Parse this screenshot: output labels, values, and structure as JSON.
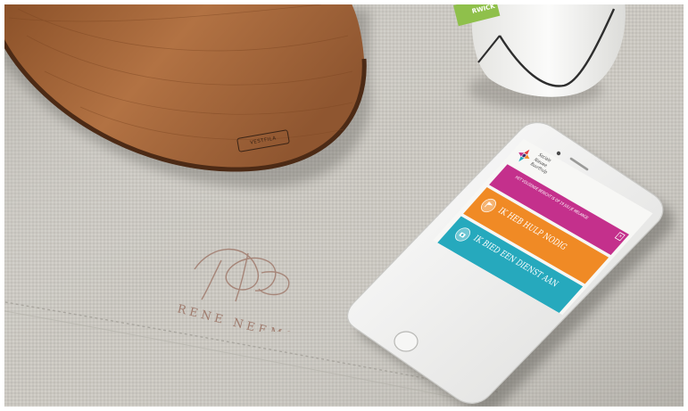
{
  "scene": {
    "description_colors": {
      "cloth": "#c7c4bd",
      "board": "#a0653a",
      "mug": "#f2f2f0",
      "phone_body": "#f4f4f2",
      "pink": "#c4308c",
      "orange": "#f08a25",
      "teal": "#26a9bd"
    }
  },
  "board": {
    "stamp_text": "VESTFILA"
  },
  "mug": {
    "label_text": "RWICK"
  },
  "embroidery": {
    "text": "RENE NEEMS"
  },
  "app": {
    "logo_lines": [
      "Sociale",
      "Nieuwe",
      "Buurthulp"
    ],
    "notice_text": "Het volgende bericht is op 19 juli je melange",
    "notice_close": "×",
    "help_button": "Ik heb hulp nodig",
    "offer_button": "Ik bied een dienst aan"
  }
}
